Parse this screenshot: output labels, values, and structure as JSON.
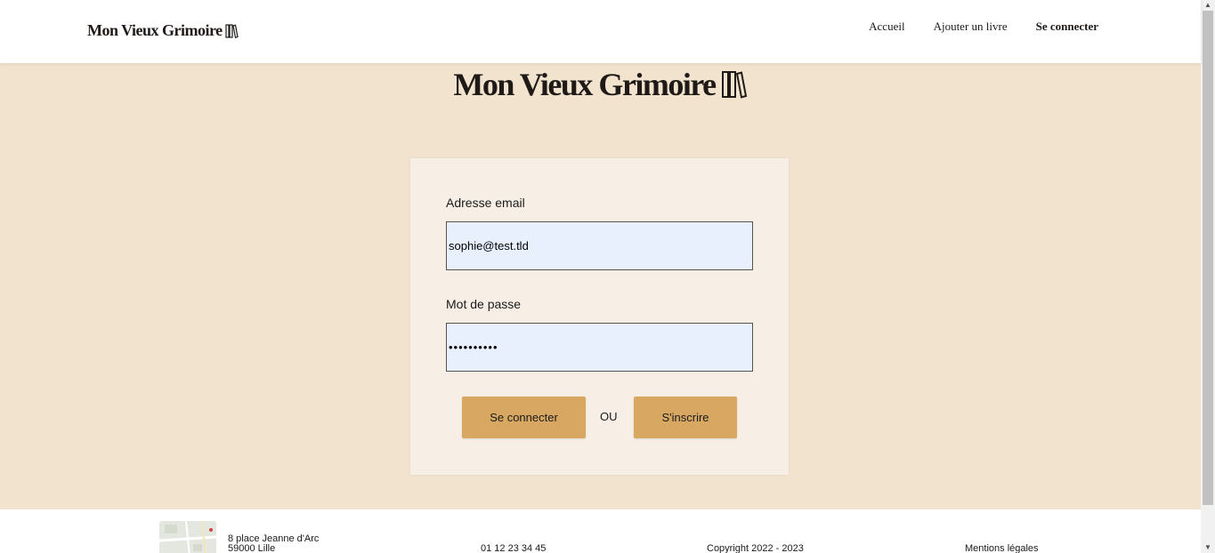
{
  "header": {
    "logo": "Mon Vieux Grimoire",
    "nav": [
      {
        "label": "Accueil"
      },
      {
        "label": "Ajouter un livre"
      },
      {
        "label": "Se connecter",
        "active": true
      }
    ]
  },
  "hero": {
    "title": "Mon Vieux Grimoire"
  },
  "login": {
    "email_label": "Adresse email",
    "email_value": "sophie@test.tld",
    "password_label": "Mot de passe",
    "password_value": "••••••••••",
    "login_button": "Se connecter",
    "or_text": "OU",
    "signup_button": "S'inscrire"
  },
  "footer": {
    "address_line1": "8 place Jeanne d'Arc",
    "address_line2": "59000 Lille",
    "phone": "01 12 23 34 45",
    "copyright": "Copyright 2022 - 2023",
    "legal": "Mentions légales"
  },
  "icons": {
    "logo_icon": "books-icon",
    "map": "map-thumbnail"
  },
  "colors": {
    "background": "#f1e3cd",
    "card": "#f7efe6",
    "button": "#d8a863",
    "input": "#e8f0fe",
    "text": "#1f1a17"
  }
}
